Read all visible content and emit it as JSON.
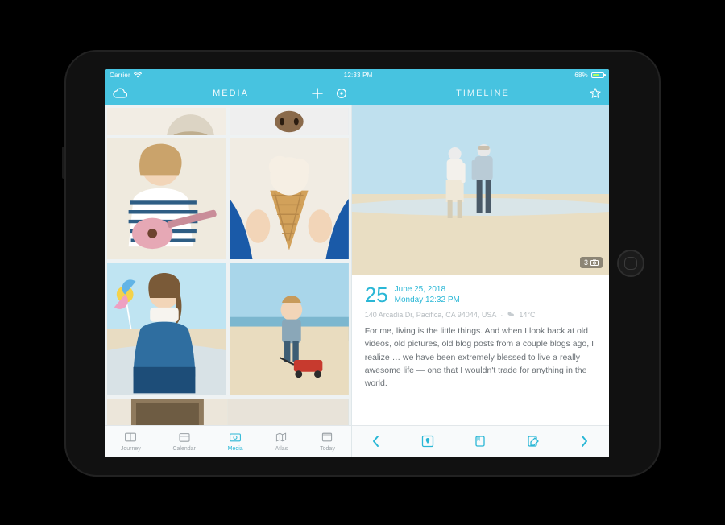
{
  "status": {
    "carrier": "Carrier",
    "time": "12:33 PM",
    "battery_percent": "68%"
  },
  "header": {
    "left": {
      "title": "MEDIA"
    },
    "right": {
      "title": "TIMELINE"
    }
  },
  "accent_color": "#47c3e0",
  "brand_blue": "#2ab7d6",
  "media": {
    "tabs": [
      {
        "label": "Journey",
        "icon": "book-icon",
        "active": false
      },
      {
        "label": "Calendar",
        "icon": "calendar-icon",
        "active": false
      },
      {
        "label": "Media",
        "icon": "photo-icon",
        "active": true
      },
      {
        "label": "Atlas",
        "icon": "map-icon",
        "active": false
      },
      {
        "label": "Today",
        "icon": "day-icon",
        "active": false
      }
    ]
  },
  "timeline": {
    "photo_count": "3",
    "date": {
      "day": "25",
      "line1": "June 25, 2018",
      "line2": "Monday 12:32 PM"
    },
    "location": "140 Arcadia Dr, Pacifica, CA 94044, USA",
    "temp": "14°C",
    "body": "For me, living is the little things. And when I look back at old videos, old pictures, old blog posts from a couple blogs ago, I realize … we have been extremely blessed to live a really awesome life — one that I wouldn't trade for anything in the world.",
    "tabs": [
      {
        "icon": "chevron-left-icon",
        "name": "prev-entry"
      },
      {
        "icon": "map-pin-icon",
        "name": "map-button"
      },
      {
        "icon": "bookmark-icon",
        "name": "bookmark-button"
      },
      {
        "icon": "edit-icon",
        "name": "edit-button"
      },
      {
        "icon": "chevron-right-icon",
        "name": "next-entry"
      }
    ]
  }
}
